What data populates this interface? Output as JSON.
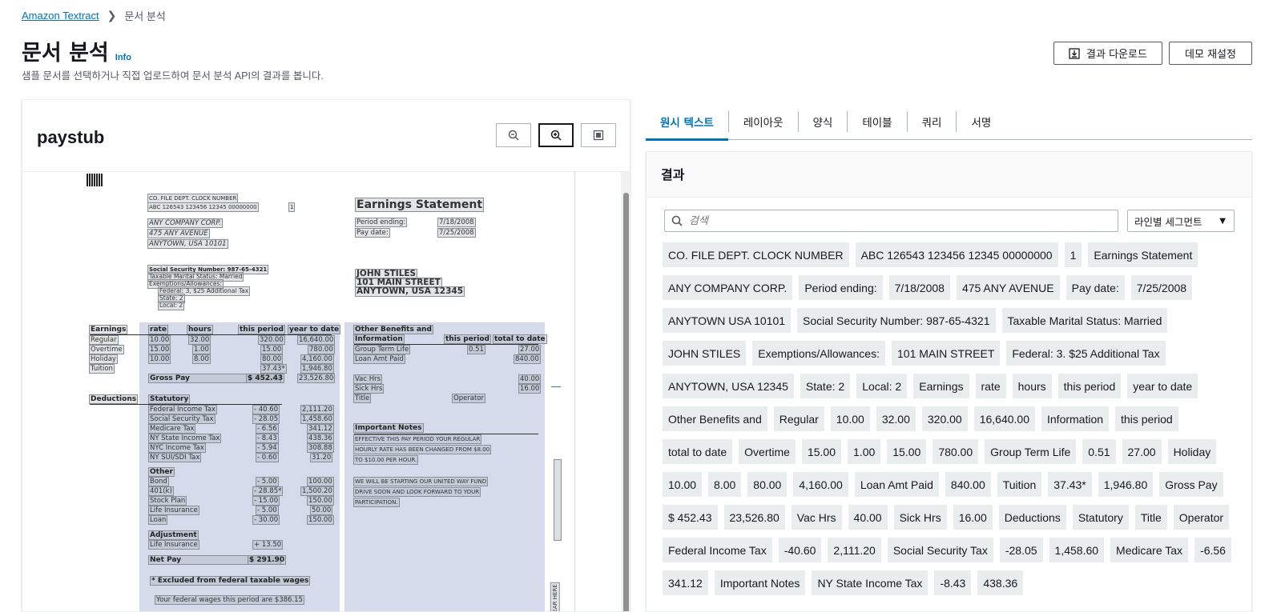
{
  "breadcrumb": {
    "root": "Amazon Textract",
    "current": "문서 분석"
  },
  "page": {
    "title": "문서 분석",
    "info": "Info",
    "description": "샘플 문서를 선택하거나 직접 업로드하여 문서 분석 API의 결과를 봅니다."
  },
  "header_buttons": {
    "download": "결과 다운로드",
    "reset": "데모 재설정"
  },
  "document": {
    "name": "paystub",
    "zoom_buttons": [
      "zoom-out-icon",
      "zoom-in-icon",
      "fit-page-icon"
    ]
  },
  "doc_text": {
    "hdr1": "CO.    FILE    DEPT.   CLOCK   NUMBER",
    "hdr2": "ABC    126543  123456  12345   00000000",
    "hdr3": "1",
    "earnings_statement": "Earnings Statement",
    "period_ending_label": "Period ending:",
    "period_ending_value": "7/18/2008",
    "pay_date_label": "Pay date:",
    "pay_date_value": "7/25/2008",
    "company": "ANY COMPANY CORP.",
    "address1": "475 ANY AVENUE",
    "address2": "ANYTOWN, USA 10101",
    "ssn": "Social Security Number: 987-65-4321",
    "marital": "Taxable Marital Status: Married",
    "exemptions": "Exemptions/Allowances:",
    "federal": "Federal:  3, $25 Additional Tax",
    "state": "State:     2",
    "local": "Local:     2",
    "emp_name": "JOHN STILES",
    "emp_addr1": "101 MAIN STREET",
    "emp_addr2": "ANYTOWN, USA 12345",
    "col_earnings": "Earnings",
    "col_rate": "rate",
    "col_hours": "hours",
    "col_this_period": "this period",
    "col_ytd": "year to date",
    "row_regular": "Regular",
    "row_overtime": "Overtime",
    "row_holiday": "Holiday",
    "row_tuition": "Tuition",
    "reg_rate": "10.00",
    "reg_hours": "32.00",
    "reg_period": "320.00",
    "reg_ytd": "16,640.00",
    "ot_rate": "15.00",
    "ot_hours": "1.00",
    "ot_period": "15.00",
    "ot_ytd": "780.00",
    "hol_rate": "10.00",
    "hol_hours": "8.00",
    "hol_period": "80.00",
    "hol_ytd": "4,160.00",
    "tui_period": "37.43*",
    "tui_ytd": "1,946.80",
    "gross_pay": "Gross Pay",
    "gross_period": "$  452.43",
    "gross_ytd": "23,526.80",
    "deductions": "Deductions",
    "statutory": "Statutory",
    "fed_tax": "Federal Income Tax",
    "fed_tax_p": "- 40.60",
    "fed_tax_y": "2,111.20",
    "ss_tax": "Social Security Tax",
    "ss_tax_p": "- 28.05",
    "ss_tax_y": "1,458.60",
    "med_tax": "Medicare Tax",
    "med_tax_p": "- 6.56",
    "med_tax_y": "341.12",
    "ny_tax": "NY State Income Tax",
    "ny_tax_p": "- 8.43",
    "ny_tax_y": "438.36",
    "nyc_tax": "NYC Income Tax",
    "nyc_tax_p": "- 5.94",
    "nyc_tax_y": "308.88",
    "nysui": "NY SUI/SDI Tax",
    "nysui_p": "- 0.60",
    "nysui_y": "31.20",
    "other": "Other",
    "bond": "Bond",
    "bond_p": "- 5.00",
    "bond_y": "100.00",
    "k401": "401(k)",
    "k401_p": "- 28.85*",
    "k401_y": "1,500.20",
    "stock": "Stock Plan",
    "stock_p": "- 15.00",
    "stock_y": "150.00",
    "life": "Life Insurance",
    "life_p": "- 5.00",
    "life_y": "50.00",
    "loan": "Loan",
    "loan_p": "- 30.00",
    "loan_y": "150.00",
    "adjustment": "Adjustment",
    "adj_life": "Life Insurance",
    "adj_life_p": "+ 13.50",
    "net_pay": "Net Pay",
    "net_pay_v": "$  291.90",
    "excluded": "* Excluded  from  federal  taxable  wages",
    "fed_wages": "Your  federal  wages  this  period  are  $386.15",
    "ob_title1": "Other Benefits and",
    "ob_title2": "Information",
    "ob_col_period": "this period",
    "ob_col_total": "total to date",
    "group_term": "Group Term Life",
    "group_term_p": "0.51",
    "group_term_t": "27.00",
    "loan_amt": "Loan Amt Paid",
    "loan_amt_t": "840.00",
    "vac": "Vac Hrs",
    "vac_t": "40.00",
    "sick": "Sick Hrs",
    "sick_t": "16.00",
    "title": "Title",
    "title_v": "Operator",
    "notes_title": "Important  Notes",
    "note1": "EFFECTIVE THIS PAY PERIOD YOUR REGULAR",
    "note2": "HOURLY RATE HAS BEEN CHANGED FROM $8.00",
    "note3": "TO $10.00 PER HOUR.",
    "note4": "WE WILL BE STARTING OUR UNITED WAY FUND",
    "note5": "DRIVE SOON AND LOOK FORWARD TO YOUR",
    "note6": "PARTICIPATION.",
    "tear": "TEAR HERE"
  },
  "tabs": [
    "원시 텍스트",
    "레이아웃",
    "양식",
    "테이블",
    "쿼리",
    "서명"
  ],
  "results": {
    "title": "결과",
    "search_placeholder": "검색",
    "segment_select": "라인별 세그먼트",
    "lines": [
      "CO. FILE DEPT. CLOCK NUMBER",
      "ABC 126543 123456 12345 00000000",
      "1",
      "Earnings Statement",
      "ANY COMPANY CORP.",
      "Period ending:",
      "7/18/2008",
      "475 ANY AVENUE",
      "Pay date:",
      "7/25/2008",
      "ANYTOWN USA 10101",
      "Social Security Number: 987-65-4321",
      "Taxable Marital Status: Married",
      "JOHN STILES",
      "Exemptions/Allowances:",
      "101 MAIN STREET",
      "Federal: 3. $25 Additional Tax",
      "ANYTOWN, USA 12345",
      "State: 2",
      "Local: 2",
      "Earnings",
      "rate",
      "hours",
      "this period",
      "year to date",
      "Other Benefits and",
      "Regular",
      "10.00",
      "32.00",
      "320.00",
      "16,640.00",
      "Information",
      "this period",
      "total to date",
      "Overtime",
      "15.00",
      "1.00",
      "15.00",
      "780.00",
      "Group Term Life",
      "0.51",
      "27.00",
      "Holiday",
      "10.00",
      "8.00",
      "80.00",
      "4,160.00",
      "Loan Amt Paid",
      "840.00",
      "Tuition",
      "37.43*",
      "1,946.80",
      "Gross Pay",
      "$ 452.43",
      "23,526.80",
      "Vac Hrs",
      "40.00",
      "Sick Hrs",
      "16.00",
      "Deductions",
      "Statutory",
      "Title",
      "Operator",
      "Federal Income Tax",
      "-40.60",
      "2,111.20",
      "Social Security Tax",
      "-28.05",
      "1,458.60",
      "Medicare Tax",
      "-6.56",
      "341.12",
      "Important Notes",
      "NY State Income Tax",
      "-8.43",
      "438.36"
    ]
  }
}
